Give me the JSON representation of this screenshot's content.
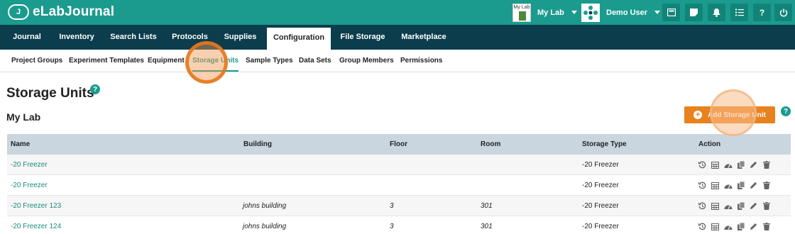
{
  "header": {
    "brand_initial": "J",
    "brand_name": "eLabJournal",
    "lab_thumb_text": "My Lab",
    "lab_name": "My Lab",
    "user_name": "Demo User",
    "buttons": [
      "inventory-icon",
      "notes-icon",
      "bell-icon",
      "tasks-icon",
      "help-icon",
      "power-icon"
    ],
    "help_label": "?"
  },
  "main_nav": [
    "Journal",
    "Inventory",
    "Search Lists",
    "Protocols",
    "Supplies",
    "Configuration",
    "File Storage",
    "Marketplace"
  ],
  "sub_nav": [
    "Project Groups",
    "Experiment Templates",
    "Equipment",
    "Storage Units",
    "Sample Types",
    "Data Sets",
    "Group Members",
    "Permissions"
  ],
  "page": {
    "title": "Storage Units",
    "help": "?",
    "lab_heading": "My Lab",
    "add_button": "Add Storage Unit",
    "add_icon": "+"
  },
  "table": {
    "columns": [
      "Name",
      "Building",
      "Floor",
      "Room",
      "Storage Type",
      "Action"
    ],
    "rows": [
      {
        "name": "-20 Freezer",
        "building": "",
        "floor": "",
        "room": "",
        "type": "-20 Freezer"
      },
      {
        "name": "-20 Freezer",
        "building": "",
        "floor": "",
        "room": "",
        "type": "-20 Freezer"
      },
      {
        "name": "-20 Freezer 123",
        "building": "johns building",
        "floor": "3",
        "room": "301",
        "type": "-20 Freezer"
      },
      {
        "name": "-20 Freezer 124",
        "building": "johns building",
        "floor": "3",
        "room": "301",
        "type": "-20 Freezer"
      }
    ],
    "action_icons": [
      "history-icon",
      "grid-icon",
      "dashboard-icon",
      "copy-icon",
      "edit-icon",
      "delete-icon"
    ]
  },
  "colors": {
    "topbar": "#1a9b8e",
    "nav": "#0c3d4c",
    "accent": "#e8821e",
    "link": "#1a8a82",
    "table_header": "#c9d6df"
  }
}
